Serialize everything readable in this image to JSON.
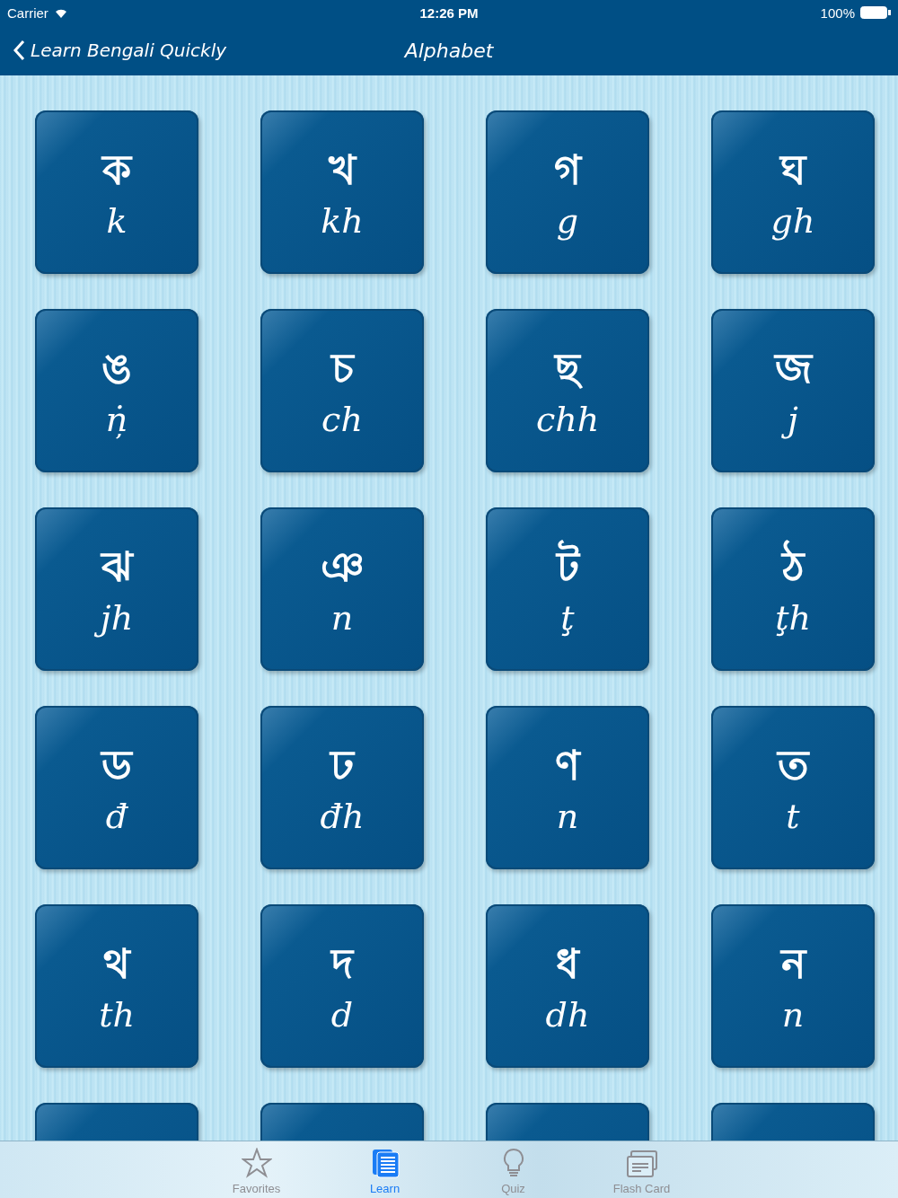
{
  "status_bar": {
    "carrier": "Carrier",
    "time": "12:26 PM",
    "battery": "100%"
  },
  "nav": {
    "back": "Learn Bengali Quickly",
    "title": "Alphabet"
  },
  "tiles": [
    {
      "kind": "letter",
      "letter": "ক",
      "roman": "k"
    },
    {
      "kind": "letter",
      "letter": "খ",
      "roman": "kh"
    },
    {
      "kind": "letter",
      "letter": "গ",
      "roman": "g"
    },
    {
      "kind": "letter",
      "letter": "ঘ",
      "roman": "gh"
    },
    {
      "kind": "letter",
      "letter": "ঙ",
      "roman": "ṅ̦"
    },
    {
      "kind": "letter",
      "letter": "চ",
      "roman": "ch"
    },
    {
      "kind": "letter",
      "letter": "ছ",
      "roman": "chh"
    },
    {
      "kind": "letter",
      "letter": "জ",
      "roman": "j"
    },
    {
      "kind": "letter",
      "letter": "ঝ",
      "roman": "jh"
    },
    {
      "kind": "letter",
      "letter": "ঞ",
      "roman": "n"
    },
    {
      "kind": "letter",
      "letter": "ট",
      "roman": "ţ"
    },
    {
      "kind": "letter",
      "letter": "ঠ",
      "roman": "ţh"
    },
    {
      "kind": "letter",
      "letter": "ড",
      "roman": "đ"
    },
    {
      "kind": "letter",
      "letter": "ঢ",
      "roman": "đh"
    },
    {
      "kind": "letter",
      "letter": "ণ",
      "roman": "n"
    },
    {
      "kind": "letter",
      "letter": "ত",
      "roman": "t"
    },
    {
      "kind": "letter",
      "letter": "থ",
      "roman": "th"
    },
    {
      "kind": "letter",
      "letter": "দ",
      "roman": "d"
    },
    {
      "kind": "letter",
      "letter": "ধ",
      "roman": "dh"
    },
    {
      "kind": "letter",
      "letter": "ন",
      "roman": "n"
    },
    {
      "kind": "cut"
    },
    {
      "kind": "cut"
    },
    {
      "kind": "cut"
    },
    {
      "kind": "cut"
    }
  ],
  "tab_bar": [
    {
      "kind": "star",
      "label": "Favorites",
      "selected": false
    },
    {
      "kind": "pages",
      "label": "Learn",
      "selected": true
    },
    {
      "kind": "bulb",
      "label": "Quiz",
      "selected": false
    },
    {
      "kind": "card",
      "label": "Flash Card",
      "selected": false
    }
  ]
}
